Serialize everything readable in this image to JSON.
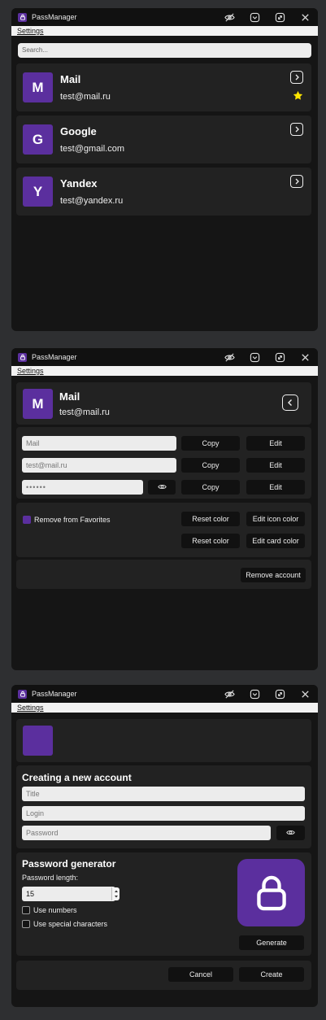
{
  "app": {
    "title": "PassManager",
    "menu_settings": "Settings",
    "accent": "#5b2f9e"
  },
  "list_view": {
    "search_placeholder": "Search...",
    "accounts": [
      {
        "initial": "M",
        "title": "Mail",
        "login": "test@mail.ru",
        "favorite": true
      },
      {
        "initial": "G",
        "title": "Google",
        "login": "test@gmail.com",
        "favorite": false
      },
      {
        "initial": "Y",
        "title": "Yandex",
        "login": "test@yandex.ru",
        "favorite": false
      }
    ]
  },
  "detail_view": {
    "initial": "M",
    "title": "Mail",
    "login": "test@mail.ru",
    "title_field_placeholder": "Mail",
    "login_field_placeholder": "test@mail.ru",
    "password_masked": "••••••",
    "copy_label": "Copy",
    "edit_label": "Edit",
    "favorite_label": "Remove from Favorites",
    "reset_color_label": "Reset color",
    "edit_icon_color_label": "Edit icon color",
    "edit_card_color_label": "Edit card color",
    "remove_account_label": "Remove account"
  },
  "create_view": {
    "heading": "Creating a new account",
    "title_placeholder": "Title",
    "login_placeholder": "Login",
    "password_placeholder": "Password",
    "generator_heading": "Password generator",
    "length_label": "Password length:",
    "length_value": "15",
    "use_numbers_label": "Use numbers",
    "use_special_label": "Use special characters",
    "generate_label": "Generate",
    "cancel_label": "Cancel",
    "create_label": "Create"
  }
}
